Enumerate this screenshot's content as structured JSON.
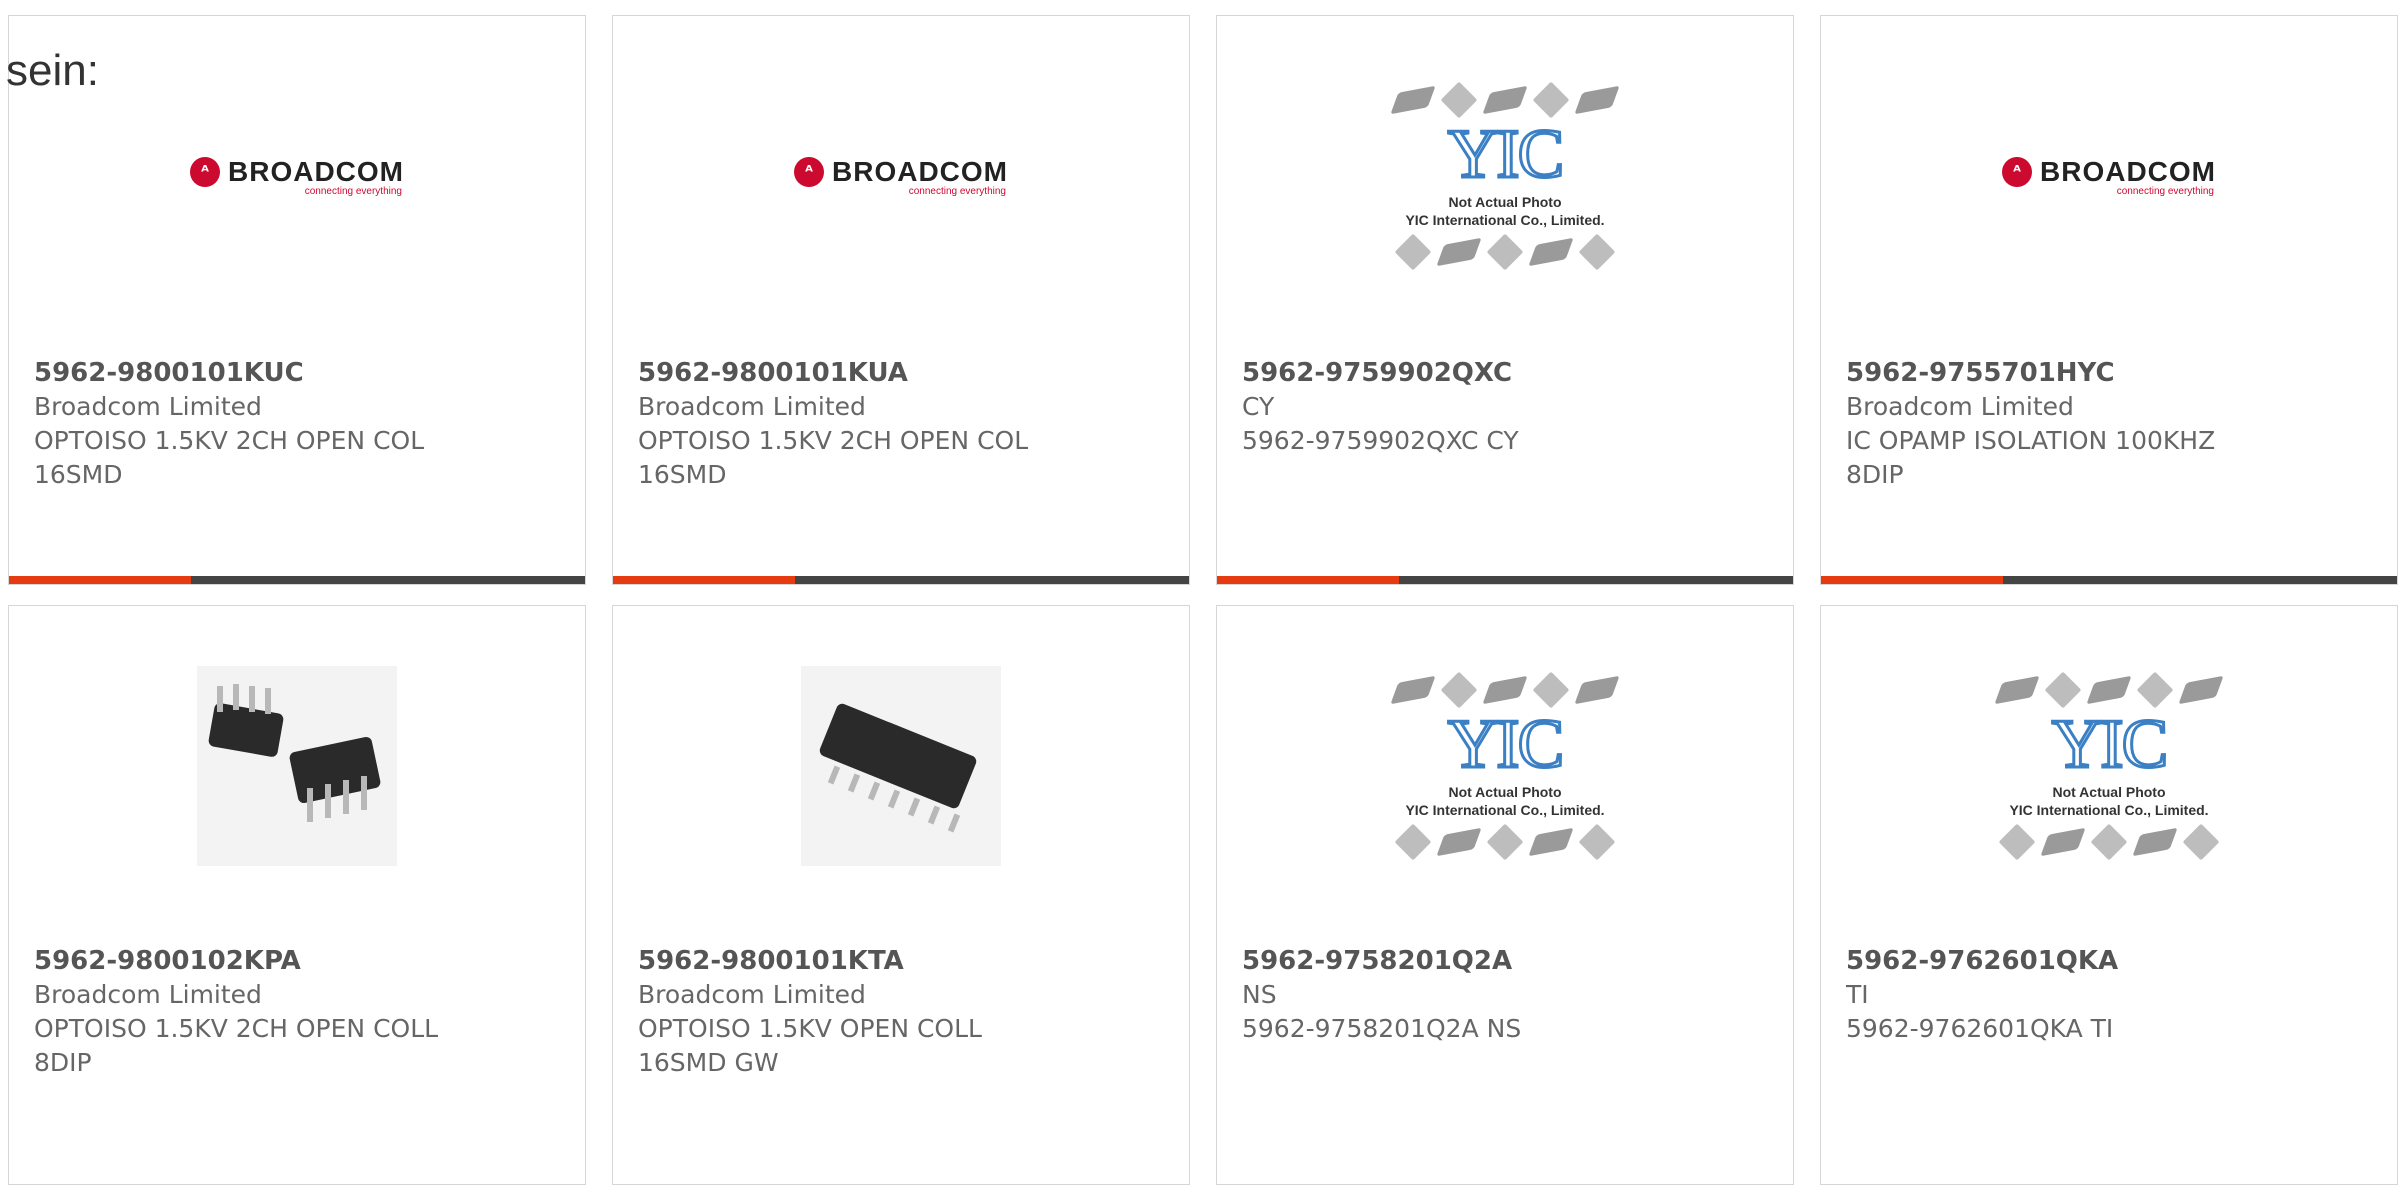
{
  "heading": "sein:",
  "colors": {
    "accent": "#e63a10",
    "bar": "#444444",
    "broadcom_red": "#cc092f",
    "yic_blue": "#3b7fc4"
  },
  "broadcom_logo": {
    "word": "BROADCOM",
    "tagline": "connecting everything"
  },
  "yic_placeholder": {
    "logo": "YIC",
    "line1": "Not Actual Photo",
    "line2": "YIC International Co., Limited."
  },
  "products": [
    {
      "part": "5962-9800101KUC",
      "manufacturer": "Broadcom Limited",
      "description": "OPTOISO 1.5KV 2CH OPEN COL 16SMD",
      "image": "broadcom-logo"
    },
    {
      "part": "5962-9800101KUA",
      "manufacturer": "Broadcom Limited",
      "description": "OPTOISO 1.5KV 2CH OPEN COL 16SMD",
      "image": "broadcom-logo"
    },
    {
      "part": "5962-9759902QXC",
      "manufacturer": "CY",
      "description": "5962-9759902QXC CY",
      "image": "yic-placeholder"
    },
    {
      "part": "5962-9755701HYC",
      "manufacturer": "Broadcom Limited",
      "description": "IC OPAMP ISOLATION 100KHZ 8DIP",
      "image": "broadcom-logo"
    },
    {
      "part": "5962-9800102KPA",
      "manufacturer": "Broadcom Limited",
      "description": "OPTOISO 1.5KV 2CH OPEN COLL 8DIP",
      "image": "dip8-photo"
    },
    {
      "part": "5962-9800101KTA",
      "manufacturer": "Broadcom Limited",
      "description": "OPTOISO 1.5KV OPEN COLL 16SMD GW",
      "image": "smd16-photo"
    },
    {
      "part": "5962-9758201Q2A",
      "manufacturer": "NS",
      "description": "5962-9758201Q2A NS",
      "image": "yic-placeholder"
    },
    {
      "part": "5962-9762601QKA",
      "manufacturer": "TI",
      "description": "5962-9762601QKA TI",
      "image": "yic-placeholder"
    }
  ]
}
